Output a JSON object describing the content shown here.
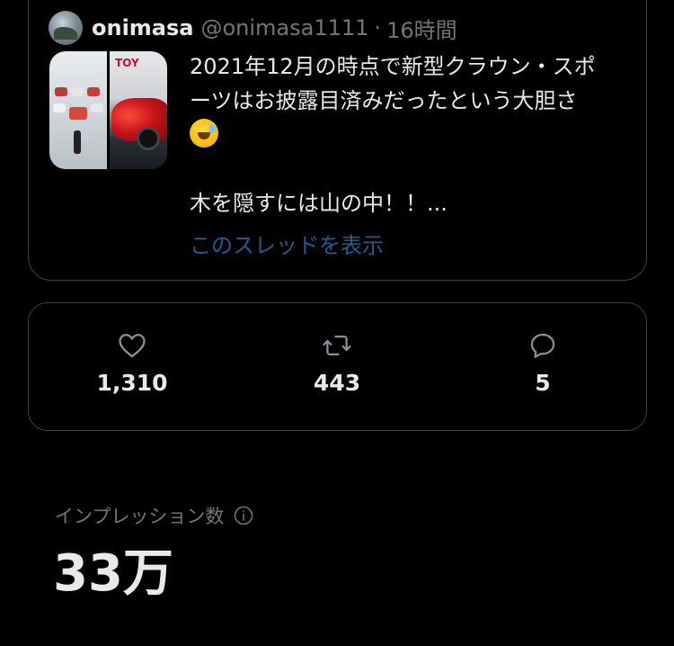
{
  "quoted_tweet": {
    "display_name": "onimasa",
    "handle": "@onimasa1111",
    "separator": "·",
    "time": "16時間",
    "text_line1": "2021年12月の時点で新型クラウン・スポ",
    "text_line2": "ーツはお披露目済みだったという大胆さ",
    "emoji": "rolling-on-floor-laughing-emoji",
    "text_line4": "木を隠すには山の中！！...",
    "show_thread": "このスレッドを表示",
    "thumbnail_sign": "TOY"
  },
  "stats": {
    "likes": "1,310",
    "retweets": "443",
    "replies": "5"
  },
  "impressions": {
    "label": "インプレッション数",
    "value": "33万"
  },
  "colors": {
    "background": "#000000",
    "text": "#e7e9ea",
    "muted": "#71767b",
    "border": "#3e4144",
    "link": "#1f5e91"
  },
  "icons": [
    "heart-icon",
    "retweet-icon",
    "reply-icon",
    "info-icon"
  ]
}
